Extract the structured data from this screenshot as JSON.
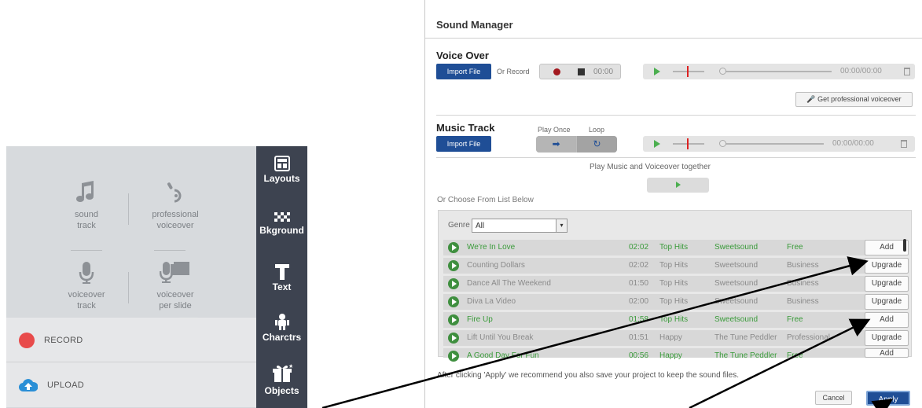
{
  "left_panel": {
    "menu": [
      {
        "name": "sound-track",
        "label_line1": "sound",
        "label_line2": "track"
      },
      {
        "name": "professional-voiceover",
        "label_line1": "professional",
        "label_line2": "voiceover"
      },
      {
        "name": "voiceover-track",
        "label_line1": "voiceover",
        "label_line2": "track"
      },
      {
        "name": "voiceover-per-slide",
        "label_line1": "voiceover",
        "label_line2": "per slide"
      }
    ],
    "actions": {
      "record": "RECORD",
      "upload": "UPLOAD"
    },
    "toolbar": [
      "Layouts",
      "Bkground",
      "Text",
      "Charctrs",
      "Objects"
    ]
  },
  "sound_manager": {
    "title": "Sound Manager",
    "voice_over": {
      "title": "Voice Over",
      "import": "Import File",
      "or_record": "Or Record",
      "record_time": "00:00",
      "time": "00:00/00:00",
      "pro_button": "Get professional voiceover"
    },
    "music_track": {
      "title": "Music Track",
      "import": "Import File",
      "play_once": "Play Once",
      "loop": "Loop",
      "time": "00:00/00:00"
    },
    "play_together": "Play Music and Voiceover together",
    "choose_label": "Or Choose From List Below",
    "genre_label": "Genre",
    "genre_value": "All",
    "tracks": [
      {
        "title": "We're In Love",
        "time": "02:02",
        "genre": "Top Hits",
        "artist": "Sweetsound",
        "license": "Free",
        "action": "Add"
      },
      {
        "title": "Counting Dollars",
        "time": "02:02",
        "genre": "Top Hits",
        "artist": "Sweetsound",
        "license": "Business",
        "action": "Upgrade"
      },
      {
        "title": "Dance All The Weekend",
        "time": "01:50",
        "genre": "Top Hits",
        "artist": "Sweetsound",
        "license": "Business",
        "action": "Upgrade"
      },
      {
        "title": "Diva La Video",
        "time": "02:00",
        "genre": "Top Hits",
        "artist": "Sweetsound",
        "license": "Business",
        "action": "Upgrade"
      },
      {
        "title": "Fire Up",
        "time": "01:58",
        "genre": "Top Hits",
        "artist": "Sweetsound",
        "license": "Free",
        "action": "Add"
      },
      {
        "title": "Lift Until You Break",
        "time": "01:51",
        "genre": "Happy",
        "artist": "The Tune Peddler",
        "license": "Professional",
        "action": "Upgrade"
      },
      {
        "title": "A Good Day For Fun",
        "time": "00:56",
        "genre": "Happy",
        "artist": "The Tune Peddler",
        "license": "Free",
        "action": "Add"
      }
    ],
    "after_note": "After clicking 'Apply' we recommend you also save your project to keep the sound files.",
    "cancel": "Cancel",
    "apply": "Apply"
  },
  "colors": {
    "toolbar_bg": "#3d4350",
    "import_blue": "#1f4e96",
    "record_red": "#e84b4b",
    "upload_blue": "#2a8fd6",
    "free_green": "#3a9b3a"
  }
}
